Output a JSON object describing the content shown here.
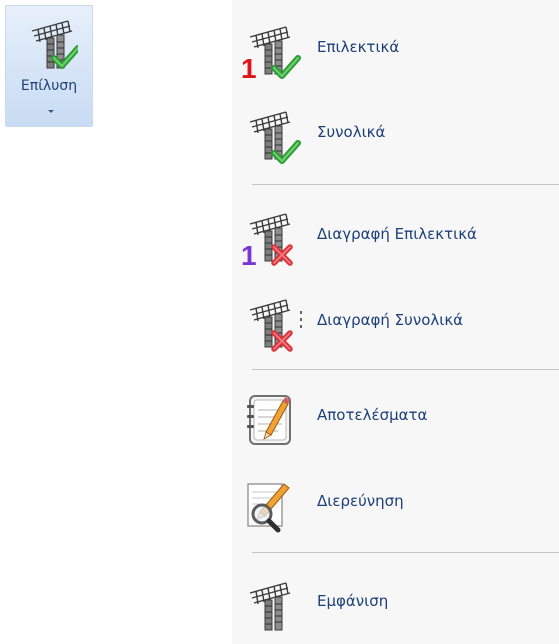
{
  "ribbon": {
    "button_label": "Επίλυση",
    "icon": "solve-check-icon"
  },
  "menu": {
    "items": [
      {
        "label": "Επιλεκτικά",
        "icon": "solve-selective-icon"
      },
      {
        "label": "Συνολικά",
        "icon": "solve-all-icon"
      },
      {
        "label": "Διαγραφή Επιλεκτικά",
        "icon": "delete-selective-icon"
      },
      {
        "label": "Διαγραφή Συνολικά",
        "icon": "delete-all-icon"
      },
      {
        "label": "Αποτελέσματα",
        "icon": "results-notebook-icon"
      },
      {
        "label": "Διερεύνηση",
        "icon": "investigation-magnifier-icon"
      },
      {
        "label": "Εμφάνιση",
        "icon": "show-frame-icon"
      }
    ]
  },
  "colors": {
    "menu_text": "#1b3f78",
    "check_green": "#34a83a",
    "cross_red": "#d9343b",
    "digit_red": "#e0141c",
    "digit_purple": "#7a37d6"
  }
}
